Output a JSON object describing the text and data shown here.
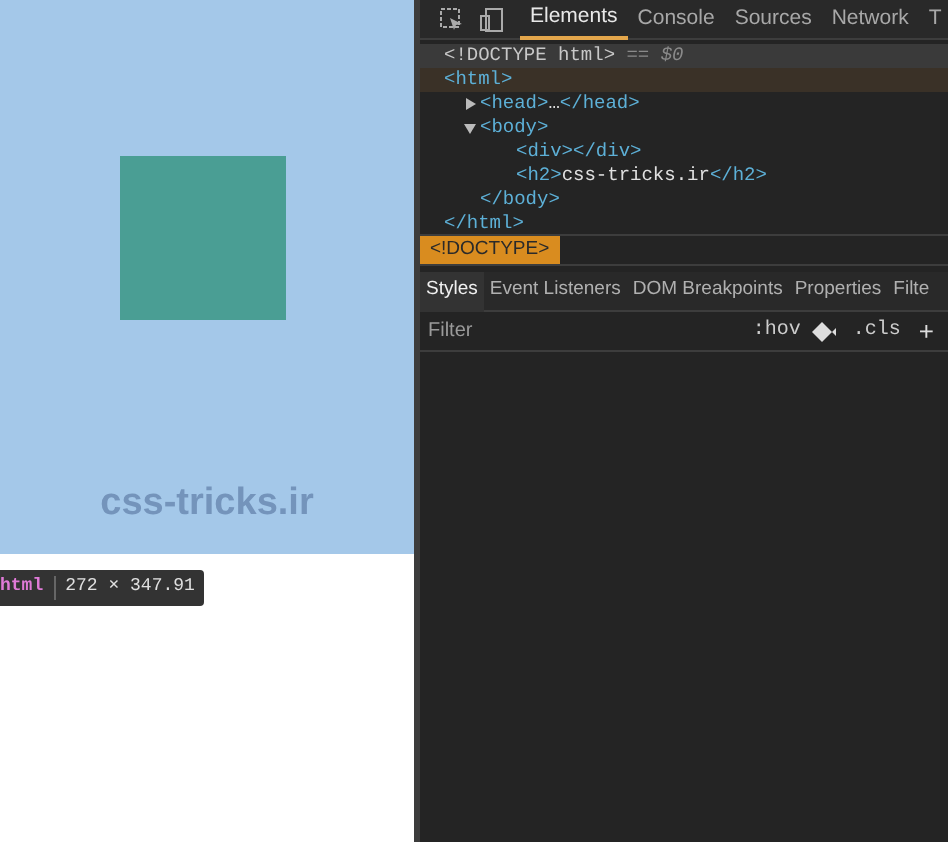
{
  "page": {
    "heading": "css-tricks.ir",
    "tooltip": {
      "tag": "html",
      "size": "272 × 347.91"
    }
  },
  "devtools": {
    "tabs": [
      {
        "label": "Elements",
        "selected": true
      },
      {
        "label": "Console",
        "selected": false
      },
      {
        "label": "Sources",
        "selected": false
      },
      {
        "label": "Network",
        "selected": false
      },
      {
        "label": "T",
        "selected": false
      }
    ],
    "dom_tree": [
      {
        "content": "<!DOCTYPE html>",
        "note": " == $0",
        "selected": true,
        "hovered": false
      },
      {
        "open": "<html>",
        "close": "</html>",
        "selected": false,
        "hovered": true,
        "children": [
          {
            "open": "<head>",
            "content": "…",
            "close": "</head>",
            "expanded": false,
            "selected": false,
            "hovered": false
          },
          {
            "open": "<body>",
            "close": "</body>",
            "expanded": true,
            "selected": false,
            "hovered": false,
            "children": [
              {
                "open": "<div>",
                "close": "</div>",
                "selected": false,
                "hovered": false
              },
              {
                "open": "<h2>",
                "content": "css-tricks.ir",
                "close": "</h2>",
                "selected": false,
                "hovered": false
              }
            ]
          }
        ]
      }
    ],
    "breadcrumbs": [
      {
        "label": "<!DOCTYPE>",
        "selected": true
      }
    ],
    "style_tabs": [
      {
        "label": "Styles",
        "selected": true
      },
      {
        "label": "Event Listeners",
        "selected": false
      },
      {
        "label": "DOM Breakpoints",
        "selected": false
      },
      {
        "label": "Properties",
        "selected": false
      },
      {
        "label": "Filte",
        "selected": false
      }
    ],
    "filter": {
      "placeholder": "Filter",
      "hov": ":hov",
      "cls": ".cls",
      "add": "+"
    }
  }
}
